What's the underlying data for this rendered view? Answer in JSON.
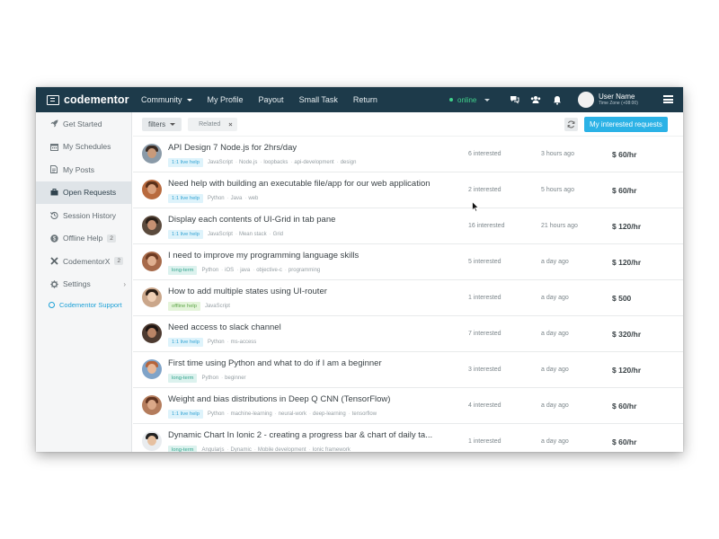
{
  "brand": {
    "name": "codementor"
  },
  "nav": [
    {
      "label": "Community",
      "has_caret": true
    },
    {
      "label": "My Profile"
    },
    {
      "label": "Payout"
    },
    {
      "label": "Small Task"
    },
    {
      "label": "Return"
    }
  ],
  "status": {
    "label": "online",
    "color": "#3fd28b"
  },
  "icons": {
    "chat": "chat-icon",
    "users": "users-icon",
    "bell": "bell-icon",
    "menu": "hamburger-icon"
  },
  "user": {
    "name": "User Name",
    "timezone": "Time Zone (+08:00)"
  },
  "sidebar": {
    "items": [
      {
        "label": "Get Started",
        "icon": "rocket-icon"
      },
      {
        "label": "My Schedules",
        "icon": "calendar-icon"
      },
      {
        "label": "My Posts",
        "icon": "document-icon"
      },
      {
        "label": "Open Requests",
        "icon": "briefcase-icon",
        "active": true
      },
      {
        "label": "Session History",
        "icon": "history-icon"
      },
      {
        "label": "Offline Help",
        "icon": "dollar-icon",
        "badge": "2"
      },
      {
        "label": "CodementorX",
        "icon": "x-icon",
        "badge": "2"
      },
      {
        "label": "Settings",
        "icon": "gear-icon",
        "chevron": true
      }
    ],
    "support": "Codementor Support"
  },
  "filters": {
    "button": "filters",
    "chip": "Related",
    "chip_close": "×",
    "primary_button": "My interested requests"
  },
  "requests": [
    {
      "title": "API Design 7 Node.js for 2hrs/day",
      "type": "1:1 live help",
      "type_kind": "live",
      "tags": [
        "JavaScript",
        "Node.js",
        "loopbacks",
        "api-development",
        "design"
      ],
      "interested": "6 interested",
      "time": "3 hours ago",
      "price": "$ 60/hr",
      "avatar": {
        "bg": "#8a9aa8",
        "skin": "#c99a7a",
        "hair": "#3a2b22"
      }
    },
    {
      "title": "Need help with building an executable file/app for our web application",
      "type": "1:1 live help",
      "type_kind": "live",
      "tags": [
        "Python",
        "Java",
        "web"
      ],
      "interested": "2 interested",
      "time": "5 hours ago",
      "price": "$ 60/hr",
      "avatar": {
        "bg": "#b86a3e",
        "skin": "#d8a07d",
        "hair": "#5a2f18"
      }
    },
    {
      "title": "Display each contents of UI-Grid in tab pane",
      "type": "1:1 live help",
      "type_kind": "live",
      "tags": [
        "JavaScript",
        "Mean stack",
        "Grid"
      ],
      "interested": "16 interested",
      "time": "21 hours ago",
      "price": "$ 120/hr",
      "avatar": {
        "bg": "#5b4a3d",
        "skin": "#c69072",
        "hair": "#2a1f18"
      }
    },
    {
      "title": "I need to improve my programming language skills",
      "type": "long-term",
      "type_kind": "long",
      "tags": [
        "Python",
        "iOS",
        "java",
        "objective-c",
        "programming"
      ],
      "interested": "5 interested",
      "time": "a day ago",
      "price": "$ 120/hr",
      "avatar": {
        "bg": "#a76a4a",
        "skin": "#e0b090",
        "hair": "#6b3a22"
      }
    },
    {
      "title": "How to add multiple states using UI-router",
      "type": "offline help",
      "type_kind": "offline",
      "tags": [
        "JavaScript"
      ],
      "interested": "1 interested",
      "time": "a day ago",
      "price": "$ 500",
      "avatar": {
        "bg": "#caa68a",
        "skin": "#efcfb5",
        "hair": "#2a1d15"
      }
    },
    {
      "title": "Need access to slack channel",
      "type": "1:1 live help",
      "type_kind": "live",
      "tags": [
        "Python",
        "ms-access"
      ],
      "interested": "7 interested",
      "time": "a day ago",
      "price": "$ 320/hr",
      "avatar": {
        "bg": "#4d3a30",
        "skin": "#b98466",
        "hair": "#1e1512"
      }
    },
    {
      "title": "First time using Python and what to do if I am a beginner",
      "type": "long-term",
      "type_kind": "long",
      "tags": [
        "Python",
        "beginner"
      ],
      "interested": "3 interested",
      "time": "a day ago",
      "price": "$ 120/hr",
      "avatar": {
        "bg": "#7fa3c8",
        "skin": "#e8b898",
        "hair": "#b5643b"
      }
    },
    {
      "title": "Weight and bias distributions in Deep Q CNN (TensorFlow)",
      "type": "1:1 live help",
      "type_kind": "live",
      "tags": [
        "Python",
        "machine-learning",
        "neural-work",
        "deep-learning",
        "tensorflow"
      ],
      "interested": "4 interested",
      "time": "a day ago",
      "price": "$ 60/hr",
      "avatar": {
        "bg": "#b47c5c",
        "skin": "#dba888",
        "hair": "#5f3320"
      }
    },
    {
      "title": "Dynamic Chart In Ionic 2 - creating a progress bar & chart of daily ta...",
      "type": "long-term",
      "type_kind": "long",
      "tags": [
        "Angularjs",
        "Dynamic",
        "Mobile development",
        "Ionic framework"
      ],
      "interested": "1 interested",
      "time": "a day ago",
      "price": "$ 60/hr",
      "avatar": {
        "bg": "#e9ecef",
        "skin": "#e6c0a0",
        "hair": "#222222"
      }
    }
  ]
}
